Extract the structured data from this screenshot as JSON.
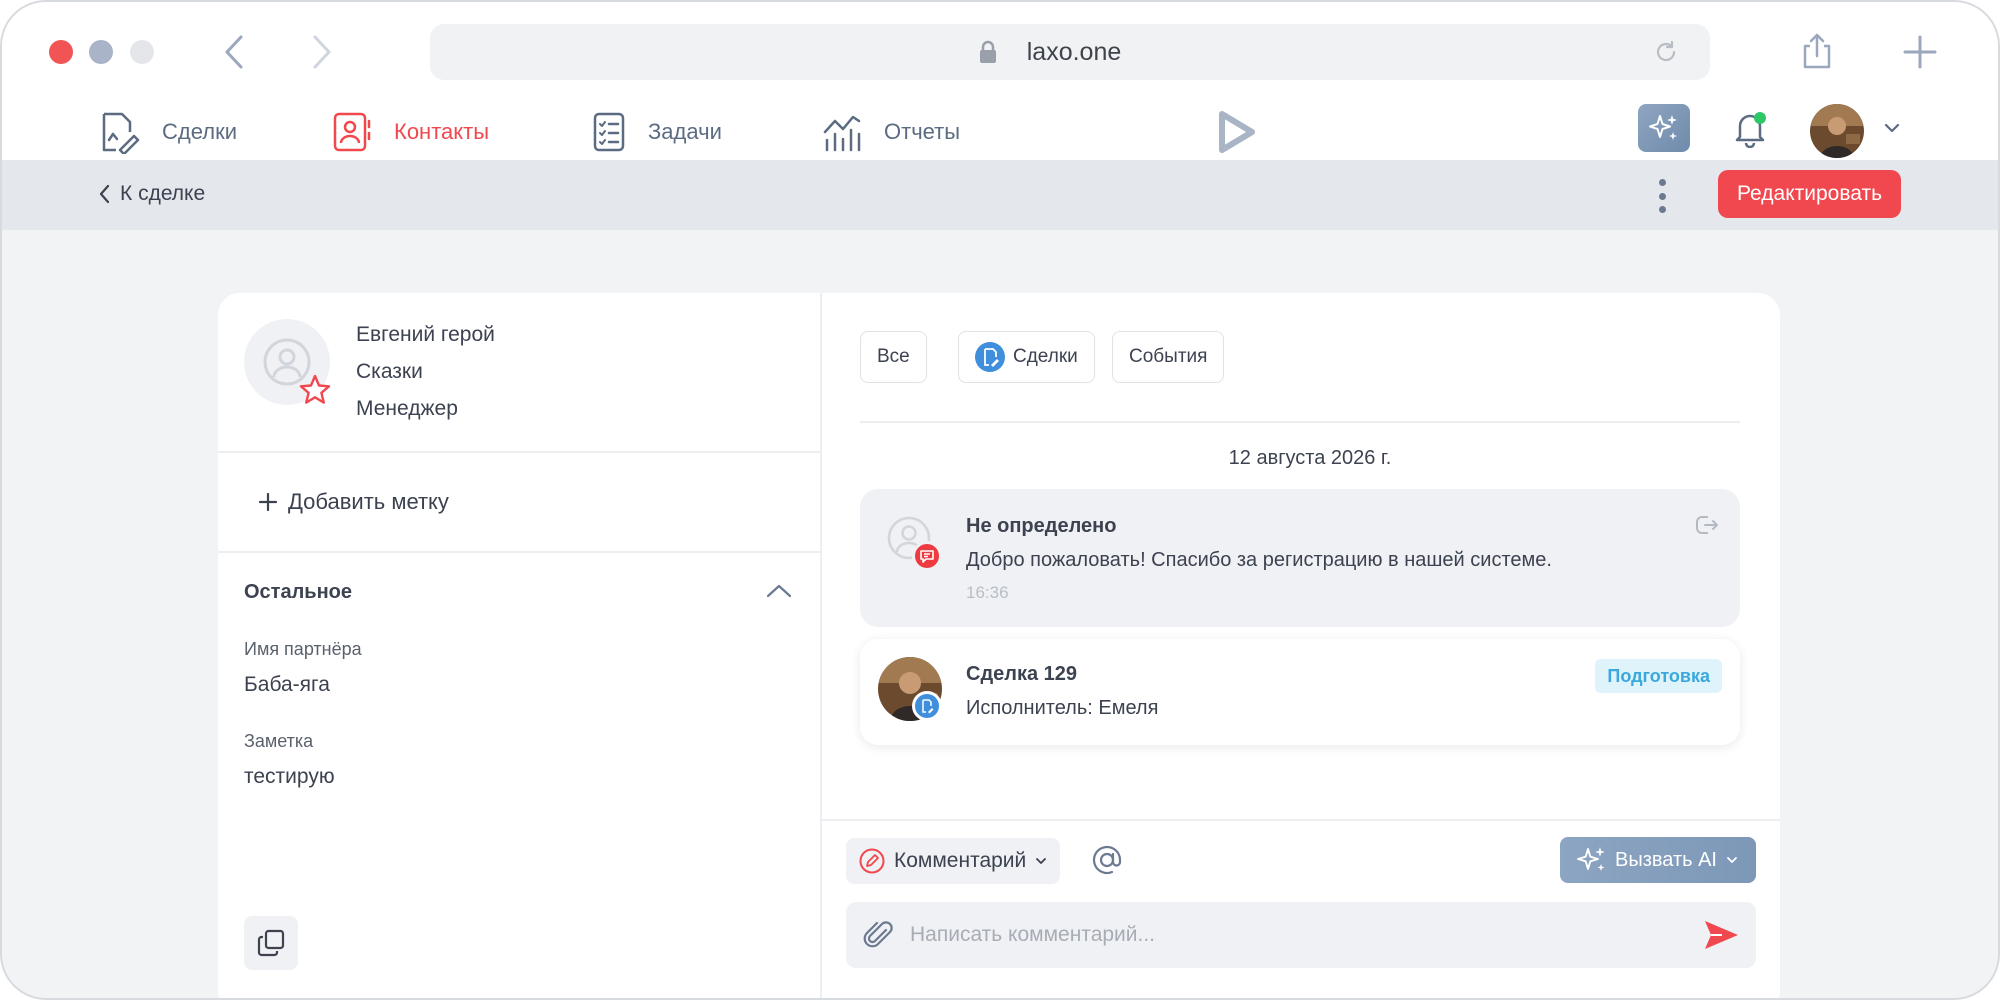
{
  "browser": {
    "url": "laxo.one"
  },
  "nav": {
    "deals": "Сделки",
    "contacts": "Контакты",
    "tasks": "Задачи",
    "reports": "Отчеты"
  },
  "subheader": {
    "back_label": "К сделке",
    "edit_label": "Редактировать"
  },
  "contact": {
    "name": "Евгений герой",
    "company": "Сказки",
    "role": "Менеджер",
    "add_tag": "Добавить метку"
  },
  "other_section": {
    "title": "Остальное",
    "fields": [
      {
        "label": "Имя партнёра",
        "value": "Баба-яга"
      },
      {
        "label": "Заметка",
        "value": "тестирую"
      }
    ]
  },
  "feed": {
    "filters": {
      "all": "Все",
      "deals": "Сделки",
      "events": "События"
    },
    "date": "12 августа 2026 г.",
    "message": {
      "title": "Не определено",
      "text": "Добро пожаловать! Спасибо за регистрацию в нашей системе.",
      "time": "16:36"
    },
    "deal": {
      "title": "Сделка 129",
      "executor": "Исполнитель: Емеля",
      "status": "Подготовка"
    }
  },
  "composer": {
    "type_label": "Комментарий",
    "ai_label": "Вызвать AI",
    "placeholder": "Написать комментарий..."
  },
  "colors": {
    "accent": "#f0484e",
    "status_bg": "#dff3fb",
    "status_text": "#3aa8dd",
    "nav_text": "#5b6b82"
  },
  "icons": [
    "lock-icon",
    "reload-icon",
    "share-icon",
    "plus-icon",
    "deals-icon",
    "contacts-icon",
    "tasks-icon",
    "reports-icon",
    "ai-sparkle-icon",
    "bell-icon",
    "chevron-down-icon",
    "chevron-left-icon",
    "kebab-icon",
    "star-icon",
    "chevron-up-icon",
    "copy-icon",
    "chat-icon",
    "exit-icon",
    "at-icon",
    "paperclip-icon",
    "send-icon"
  ]
}
